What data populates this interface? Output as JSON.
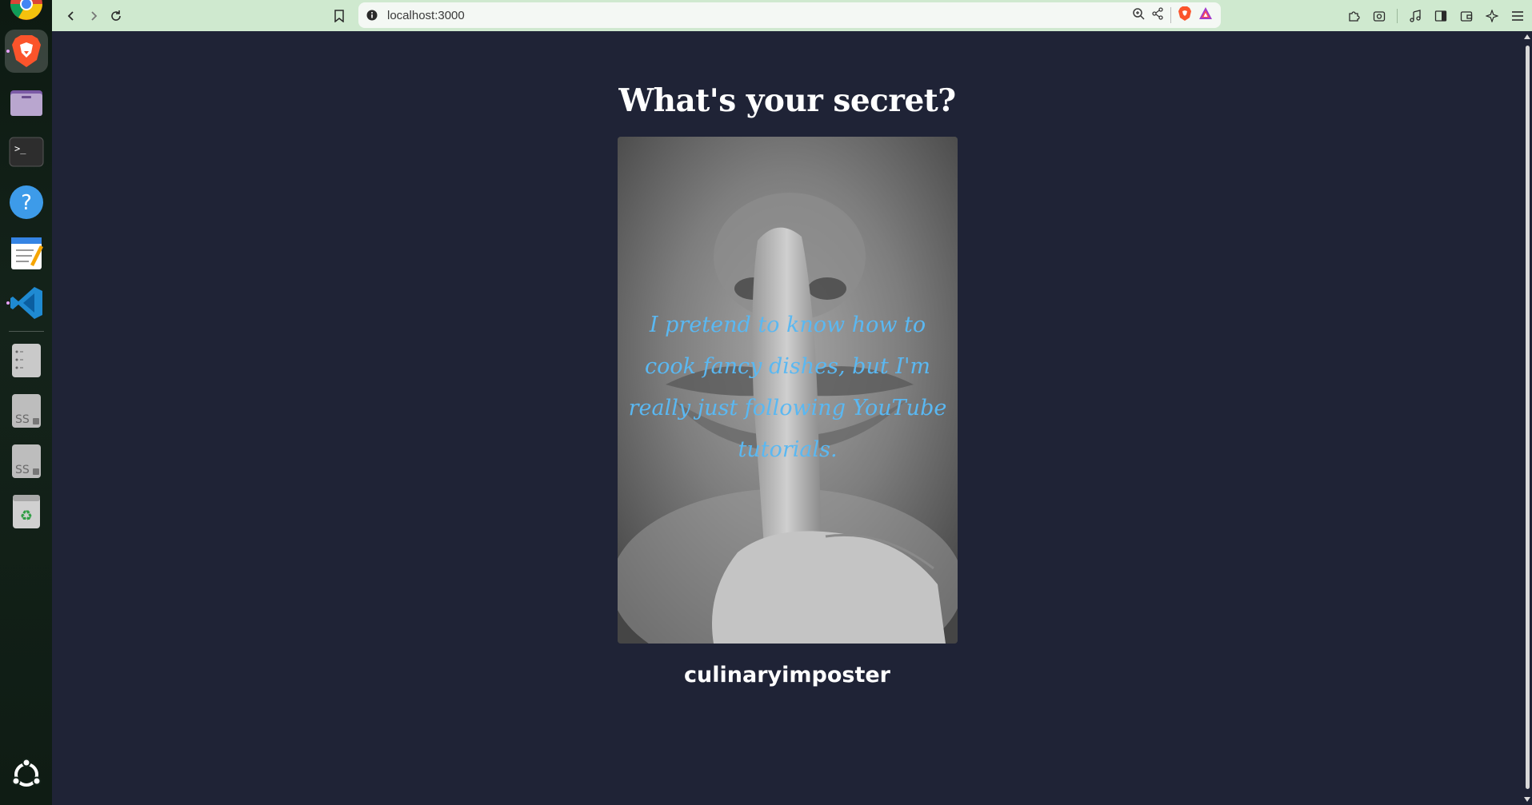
{
  "browser": {
    "url": "localhost:3000"
  },
  "dock": {
    "apps": [
      {
        "name": "chrome"
      },
      {
        "name": "brave",
        "active": true
      },
      {
        "name": "files"
      },
      {
        "name": "terminal"
      },
      {
        "name": "help"
      },
      {
        "name": "text-editor"
      },
      {
        "name": "vscode"
      },
      {
        "name": "disks"
      },
      {
        "name": "ssd-1"
      },
      {
        "name": "ssd-2"
      },
      {
        "name": "trash"
      }
    ]
  },
  "page": {
    "title": "What's your secret?",
    "secret": "I pretend to know how to cook fancy dishes, but I'm really just following YouTube tutorials.",
    "username": "culinaryimposter"
  },
  "colors": {
    "page_bg": "#1f2336",
    "toolbar_bg": "#cfe9cf",
    "secret_text": "#5ab8f2"
  }
}
